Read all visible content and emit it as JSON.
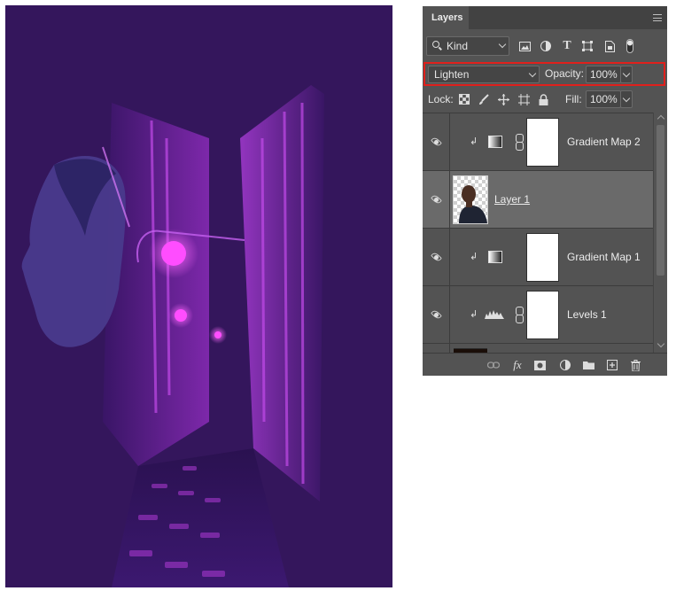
{
  "panel": {
    "tab_label": "Layers",
    "filter": {
      "kind_label": "Kind"
    },
    "blend": {
      "mode": "Lighten",
      "opacity_label": "Opacity:",
      "opacity_value": "100%"
    },
    "lock": {
      "lock_label": "Lock:",
      "fill_label": "Fill:",
      "fill_value": "100%"
    },
    "layers": [
      {
        "name": "Gradient Map 2",
        "type": "gradient-map",
        "clipped": true,
        "visible": true,
        "selected": false
      },
      {
        "name": "Layer 1",
        "type": "pixel",
        "clipped": false,
        "visible": true,
        "selected": true
      },
      {
        "name": "Gradient Map 1",
        "type": "gradient-map",
        "clipped": true,
        "visible": true,
        "selected": false
      },
      {
        "name": "Levels 1",
        "type": "levels",
        "clipped": true,
        "visible": true,
        "selected": false
      }
    ]
  },
  "colors": {
    "canvas_bg": "#34165c",
    "accent_magenta": "#e040ff",
    "panel_bg": "#535353",
    "highlight_border": "#e0201c"
  }
}
